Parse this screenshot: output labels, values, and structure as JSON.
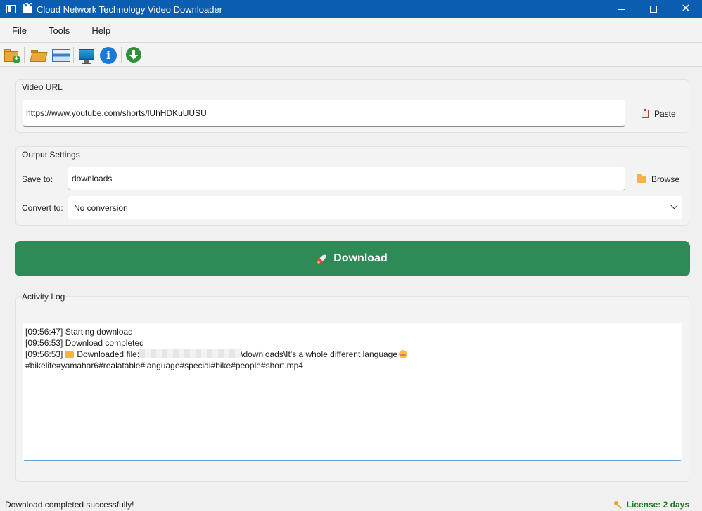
{
  "window": {
    "title": "Cloud Network Technology Video Downloader",
    "controls": {
      "minimize": "minimize",
      "maximize": "maximize",
      "close": "✕"
    }
  },
  "menu": [
    "File",
    "Tools",
    "Help"
  ],
  "toolbar": {
    "icons": [
      "new-folder-icon",
      "open-folder-icon",
      "window-icon",
      "monitor-icon",
      "info-icon",
      "download-arrow-icon"
    ]
  },
  "video_url": {
    "group_title": "Video URL",
    "value": "https://www.youtube.com/shorts/lUhHDKuUUSU",
    "paste_label": "Paste"
  },
  "output_settings": {
    "group_title": "Output Settings",
    "save_to_label": "Save to:",
    "save_to_value": "downloads",
    "browse_label": "Browse",
    "convert_to_label": "Convert to:",
    "convert_to_value": "No conversion"
  },
  "download_button": {
    "label": "Download"
  },
  "activity_log": {
    "group_title": "Activity Log",
    "lines": [
      {
        "time": "[09:56:47]",
        "text": "Starting download"
      },
      {
        "time": "[09:56:53]",
        "text": "Download completed"
      },
      {
        "time": "[09:56:53]",
        "prefix": "Downloaded file:",
        "path": "\\downloads\\It's a whole different language",
        "continuation": "#bikelife#yamahar6#realatable#language#special#bike#people#short.mp4"
      }
    ]
  },
  "status": {
    "message": "Download completed successfully!",
    "license": "License: 2 days"
  },
  "colors": {
    "titlebar": "#0a5db0",
    "download_button": "#2e8b57",
    "license_text": "#1f7a1f"
  }
}
